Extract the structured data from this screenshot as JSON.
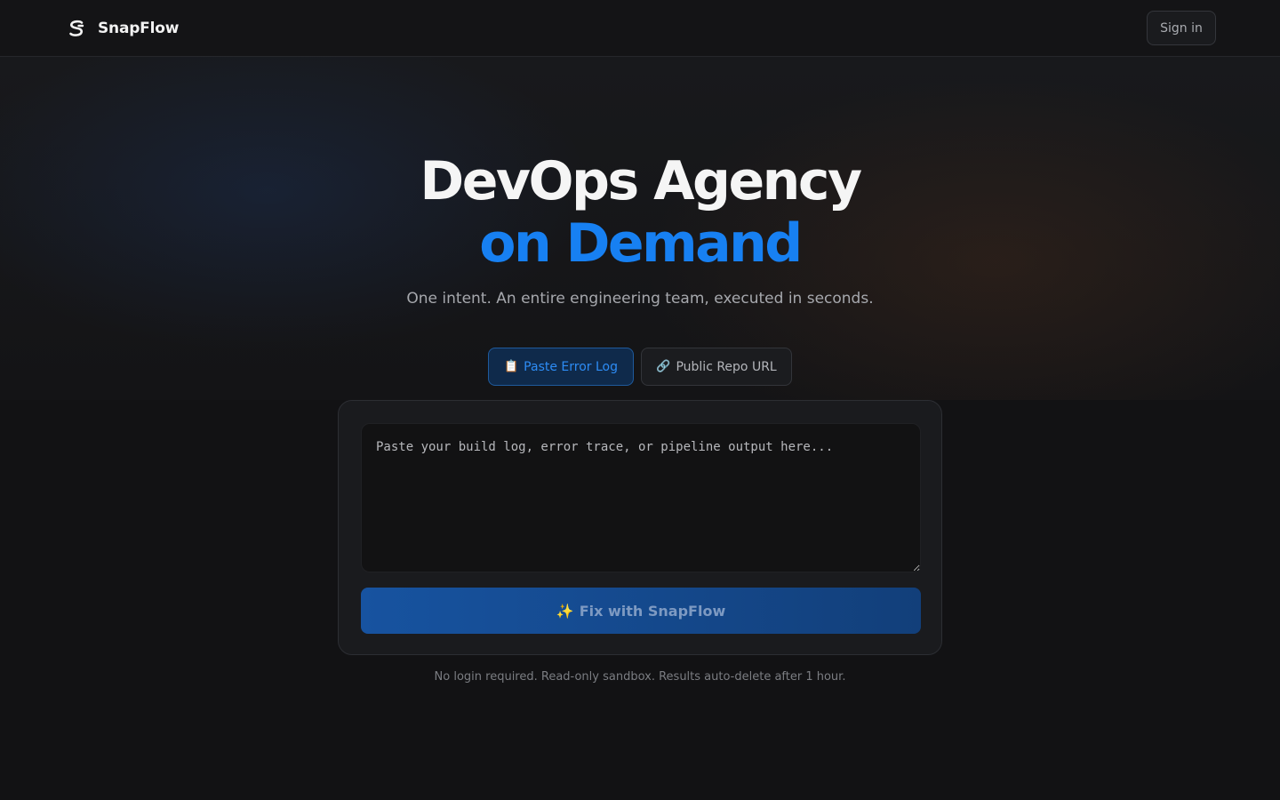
{
  "header": {
    "brand_name": "SnapFlow",
    "brand_icon": "snapflow-logo-icon",
    "signin_label": "Sign in"
  },
  "hero": {
    "title_line1": "DevOps Agency",
    "title_line2": "on Demand",
    "subtitle": "One intent. An entire engineering team, executed in seconds."
  },
  "tabs": [
    {
      "icon": "📋",
      "icon_name": "clipboard-icon",
      "label": "Paste Error Log",
      "active": true
    },
    {
      "icon": "🔗",
      "icon_name": "link-icon",
      "label": "Public Repo URL",
      "active": false
    }
  ],
  "input": {
    "placeholder": "Paste your build log, error trace, or pipeline output here...",
    "value": ""
  },
  "action": {
    "icon": "✨",
    "icon_name": "sparkles-icon",
    "label": "Fix with SnapFlow"
  },
  "footnote": "No login required. Read-only sandbox. Results auto-delete after 1 hour.",
  "colors": {
    "accent": "#1780f2",
    "background": "#121214",
    "card": "#1a1b1e",
    "button": "#1753a0"
  }
}
